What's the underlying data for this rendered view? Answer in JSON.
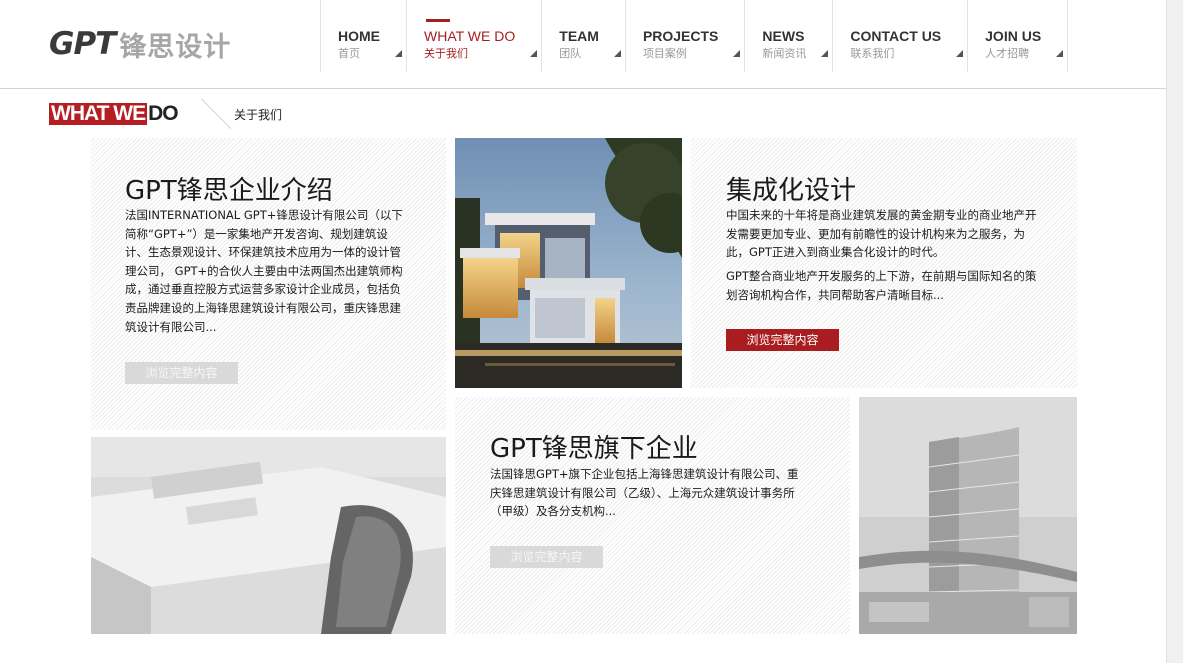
{
  "brand": {
    "logo_mark": "GPT",
    "logo_text": "锋思设计"
  },
  "nav": [
    {
      "en": "HOME",
      "cn": "首页",
      "active": false
    },
    {
      "en": "WHAT WE DO",
      "cn": "关于我们",
      "active": true
    },
    {
      "en": "TEAM",
      "cn": "团队",
      "active": false
    },
    {
      "en": "PROJECTS",
      "cn": "项目案例",
      "active": false
    },
    {
      "en": "NEWS",
      "cn": "新闻资讯",
      "active": false
    },
    {
      "en": "CONTACT US",
      "cn": "联系我们",
      "active": false
    },
    {
      "en": "JOIN US",
      "cn": "人才招聘",
      "active": false
    }
  ],
  "section": {
    "title_red": "WHAT WE",
    "title_dark": "DO",
    "subtitle": "关于我们"
  },
  "panels": {
    "intro": {
      "title": "GPT锋思企业介绍",
      "body": "法国INTERNATIONAL GPT+锋思设计有限公司（以下简称“GPT+”）是一家集地产开发咨询、规划建筑设计、生态景观设计、环保建筑技术应用为一体的设计管理公司， GPT+的合伙人主要由中法两国杰出建筑师构成，通过垂直控股方式运营多家设计企业成员，包括负责品牌建设的上海锋思建筑设计有限公司，重庆锋思建筑设计有限公司...",
      "button": "浏览完整内容"
    },
    "integrated": {
      "title": "集成化设计",
      "body1": "中国未来的十年将是商业建筑发展的黄金期专业的商业地产开发需要更加专业、更加有前瞻性的设计机构来为之服务，为此，GPT正进入到商业集合化设计的时代。",
      "body2": "GPT整合商业地产开发服务的上下游，在前期与国际知名的策划咨询机构合作，共同帮助客户清晰目标...",
      "button": "浏览完整内容"
    },
    "subsidiaries": {
      "title": "GPT锋思旗下企业",
      "body": "法国锋思GPT+旗下企业包括上海锋思建筑设计有限公司、重庆锋思建筑设计有限公司（乙级）、上海元众建筑设计事务所（甲级）及各分支机构...",
      "button": "浏览完整内容"
    }
  },
  "colors": {
    "accent": "#a91c1f",
    "text": "#1c1c1c"
  }
}
